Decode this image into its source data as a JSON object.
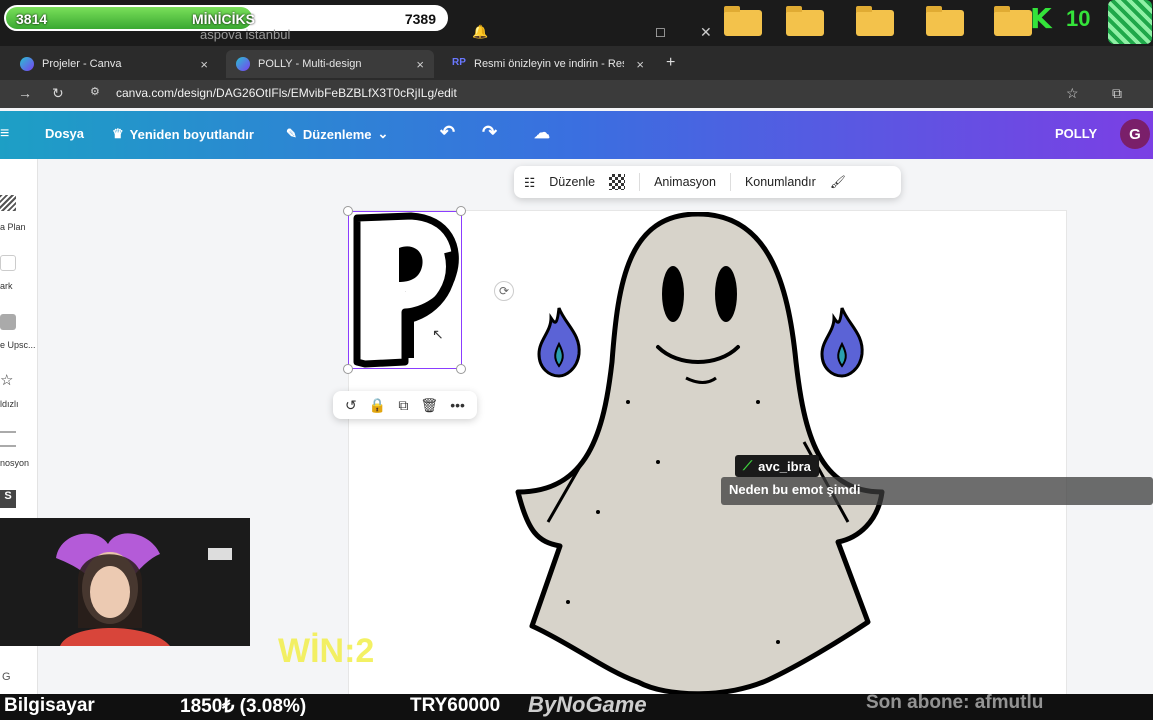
{
  "overlay": {
    "left_value": "3814",
    "title": "MİNİCİKS",
    "right_value": "7389",
    "progress": 0.56,
    "search_text": "aspova istanbul",
    "k_label": "K",
    "count_label": "10",
    "win_text": "WİN:2"
  },
  "tabs": [
    {
      "label": "Projeler - Canva",
      "icon": "canva-icon",
      "close": "×"
    },
    {
      "label": "POLLY - Multi-design",
      "icon": "canva-icon",
      "close": "×"
    },
    {
      "label": "Resmi önizleyin ve indirin - Res",
      "icon": "rp-icon",
      "badge": "RP",
      "close": "×"
    }
  ],
  "new_tab": "+",
  "address": {
    "url": "canva.com/design/DAG26OtIFls/EMvibFeBZBLfX3T0cRjILg/edit"
  },
  "canva_header": {
    "file": "Dosya",
    "resize": "Yeniden boyutlandır",
    "edit": "Düzenleme",
    "design_name": "POLLY",
    "avatar": "G"
  },
  "sidebar": {
    "items": [
      "a Plan",
      "ark",
      "e Upsc...",
      "ldızlı",
      "nosyon"
    ]
  },
  "float_toolbar": {
    "edit": "Düzenle",
    "animation": "Animasyon",
    "position": "Konumlandır"
  },
  "canvas": {
    "letter": "P"
  },
  "chat": {
    "username": "avc_ibra",
    "message": "Neden bu emot şimdi"
  },
  "ticker": {
    "left": "Bilgisayar",
    "price": "1850₺ (3.08%)",
    "total": "TRY60000",
    "brand": "ByNoGame",
    "subscriber": "Son abone: afmutlu"
  },
  "colors": {
    "canva_purple": "#8b3dff",
    "flame_blue": "#5b63d6",
    "ghost_fill": "#d7d3ca",
    "progress_green": "#3aa832"
  }
}
